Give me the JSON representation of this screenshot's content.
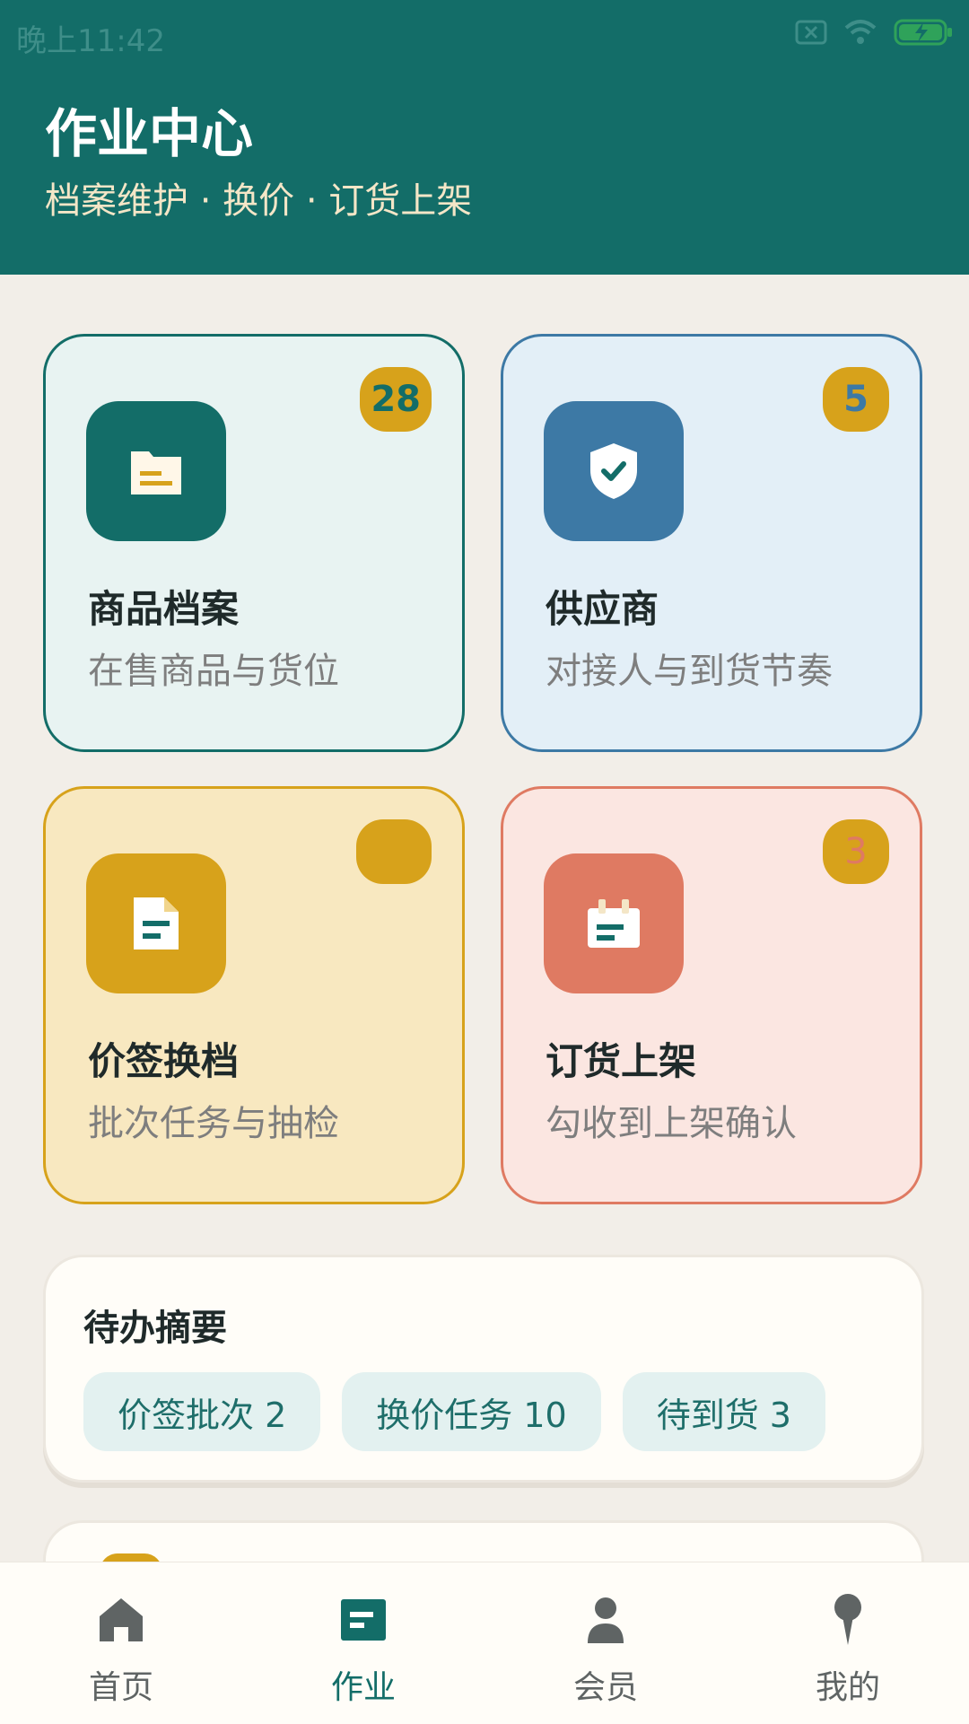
{
  "status": {
    "time": "晚上11:42"
  },
  "header": {
    "title": "作业中心",
    "subtitle": "档案维护 · 换价 · 订货上架"
  },
  "cards": [
    {
      "title": "商品档案",
      "desc": "在售商品与货位",
      "badge": "28",
      "icon": "folder-icon",
      "color": "#136D68"
    },
    {
      "title": "供应商",
      "desc": "对接人与到货节奏",
      "badge": "5",
      "icon": "shield-check-icon",
      "color": "#3D79A5"
    },
    {
      "title": "价签换档",
      "desc": "批次任务与抽检",
      "badge": "",
      "icon": "document-icon",
      "color": "#D7A21B"
    },
    {
      "title": "订货上架",
      "desc": "勾收到上架确认",
      "badge": "3",
      "icon": "calendar-icon",
      "color": "#DF7A62"
    }
  ],
  "summary": {
    "title": "待办摘要",
    "chips": [
      "价签批次 2",
      "换价任务 10",
      "待到货 3"
    ]
  },
  "tabs": [
    {
      "label": "首页",
      "icon": "home-icon"
    },
    {
      "label": "作业",
      "icon": "work-icon",
      "active": true
    },
    {
      "label": "会员",
      "icon": "member-icon"
    },
    {
      "label": "我的",
      "icon": "location-pin-icon"
    }
  ],
  "colors": {
    "primary": "#136D68",
    "background": "#F2EEE8",
    "accent": "#D7A21B"
  }
}
